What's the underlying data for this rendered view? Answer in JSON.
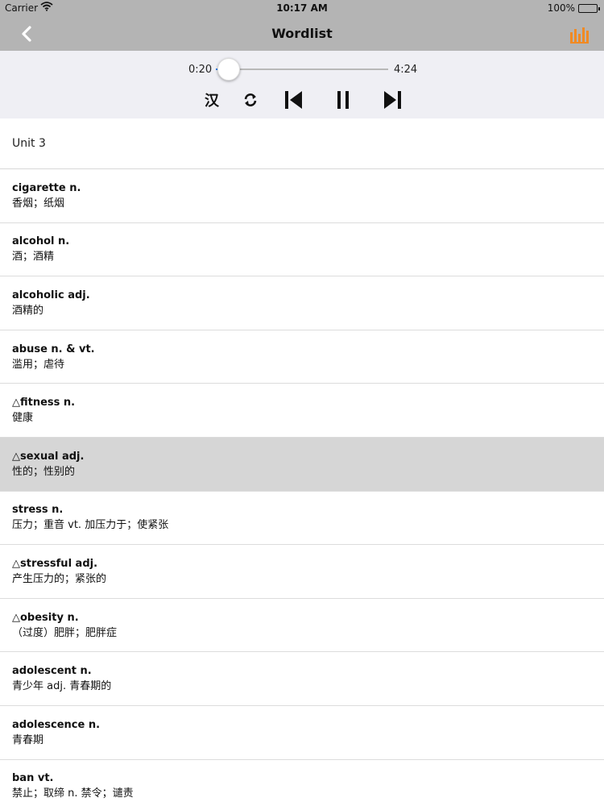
{
  "status_bar": {
    "carrier": "Carrier",
    "time": "10:17 AM",
    "battery": "100%"
  },
  "nav": {
    "title": "Wordlist",
    "accent_color": "#f08a24"
  },
  "player": {
    "current_time": "0:20",
    "total_time": "4:24",
    "progress": 0.076,
    "han_label": "汉",
    "track_color": "#2f7fea"
  },
  "section": {
    "title": "Unit 3"
  },
  "words": [
    {
      "word": "cigarette n.",
      "meaning": "香烟；纸烟"
    },
    {
      "word": "alcohol n.",
      "meaning": "酒；酒精"
    },
    {
      "word": "alcoholic adj.",
      "meaning": "酒精的"
    },
    {
      "word": "abuse n. & vt.",
      "meaning": "滥用；虐待"
    },
    {
      "word": "△fitness n.",
      "meaning": "健康"
    },
    {
      "word": "△sexual adj.",
      "meaning": "性的；性别的",
      "selected": true
    },
    {
      "word": "stress n.",
      "meaning": "压力；重音 vt. 加压力于；使紧张"
    },
    {
      "word": "△stressful adj.",
      "meaning": "产生压力的；紧张的"
    },
    {
      "word": "△obesity n.",
      "meaning": "（过度）肥胖；肥胖症"
    },
    {
      "word": "adolescent n.",
      "meaning": "青少年 adj. 青春期的"
    },
    {
      "word": "adolescence n.",
      "meaning": "青春期"
    },
    {
      "word": "ban vt.",
      "meaning": "禁止；取缔 n. 禁令；谴责"
    }
  ]
}
